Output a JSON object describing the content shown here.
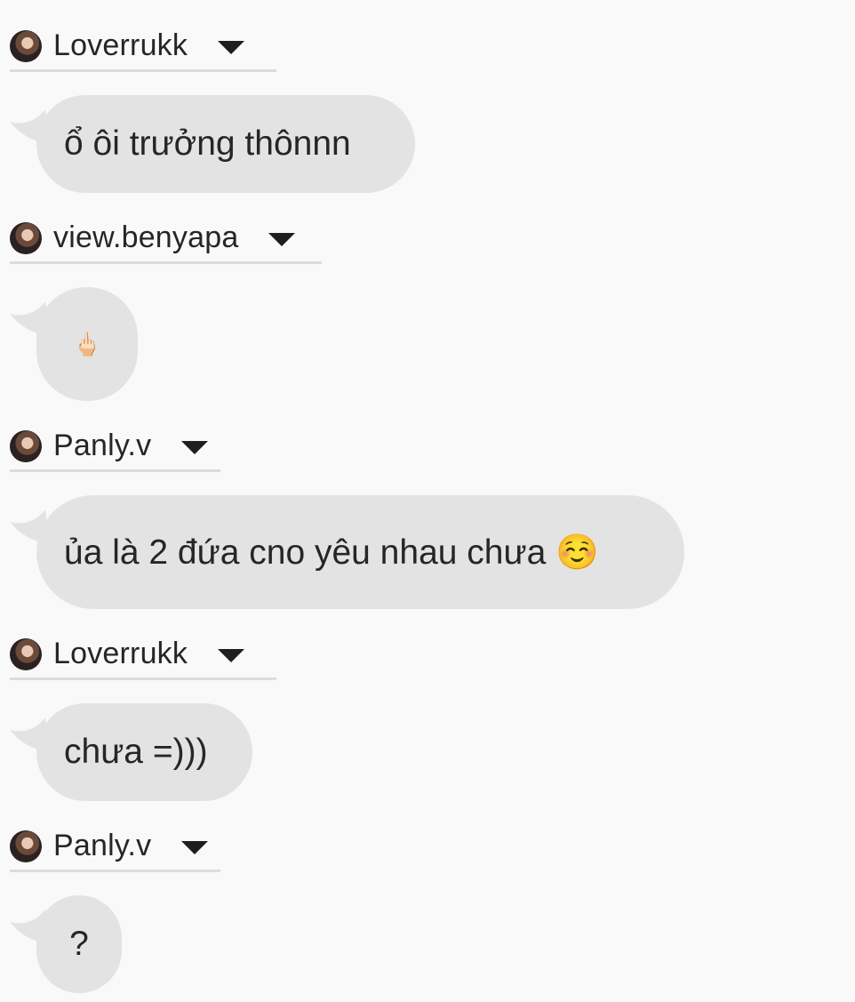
{
  "messages": [
    {
      "username": "Loverrukk",
      "text": "ổ ôi trưởng thônnn"
    },
    {
      "username": "view.benyapa",
      "text": "🖕🏻"
    },
    {
      "username": "Panly.v",
      "text": "ủa là 2 đứa cno yêu nhau chưa ☺️"
    },
    {
      "username": "Loverrukk",
      "text": "chưa =)))"
    },
    {
      "username": "Panly.v",
      "text": "?"
    }
  ]
}
